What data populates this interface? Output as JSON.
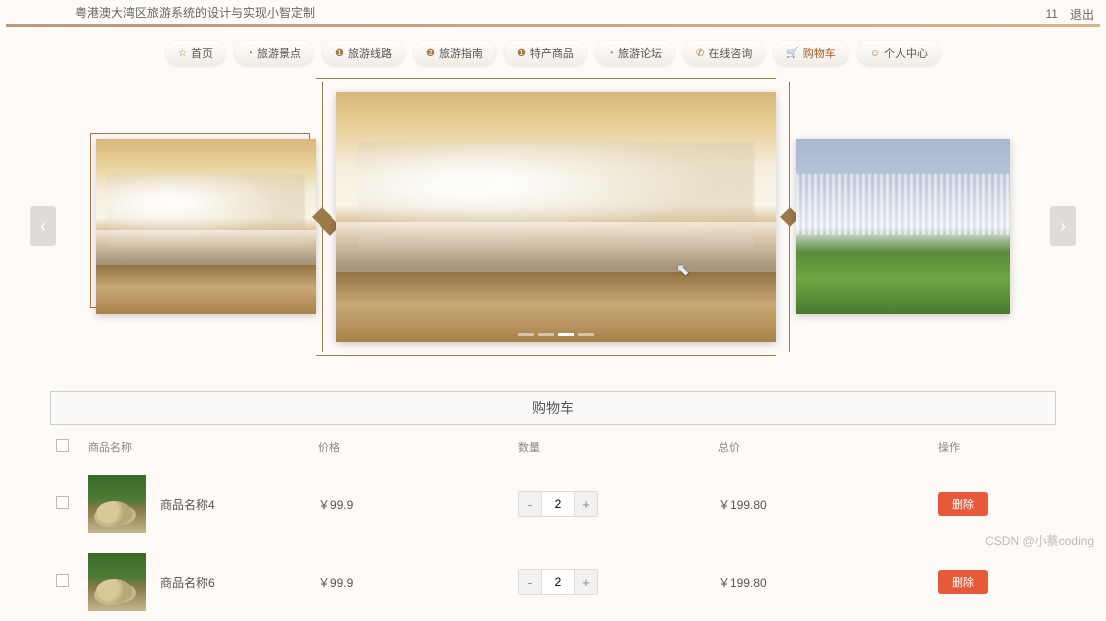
{
  "header": {
    "site_title": "粤港澳大湾区旅游系统的设计与实现小智定制",
    "user_id": "11",
    "logout": "退出"
  },
  "nav": {
    "items": [
      {
        "icon": "☆",
        "label": "首页"
      },
      {
        "icon": "◔",
        "label": "旅游景点"
      },
      {
        "icon": "❶",
        "label": "旅游线路"
      },
      {
        "icon": "❷",
        "label": "旅游指南"
      },
      {
        "icon": "❶",
        "label": "特产商品"
      },
      {
        "icon": "◔",
        "label": "旅游论坛"
      },
      {
        "icon": "✆",
        "label": "在线咨询"
      },
      {
        "icon": "🛒",
        "label": "购物车",
        "active": true
      },
      {
        "icon": "☺",
        "label": "个人中心"
      }
    ]
  },
  "cart": {
    "title": "购物车",
    "columns": {
      "name": "商品名称",
      "price": "价格",
      "qty": "数量",
      "total": "总价",
      "action": "操作"
    },
    "delete_label": "删除",
    "items": [
      {
        "name": "商品名称4",
        "price": "￥99.9",
        "qty": "2",
        "total": "￥199.80"
      },
      {
        "name": "商品名称6",
        "price": "￥99.9",
        "qty": "2",
        "total": "￥199.80"
      }
    ]
  },
  "watermark": "CSDN @小蔡coding"
}
